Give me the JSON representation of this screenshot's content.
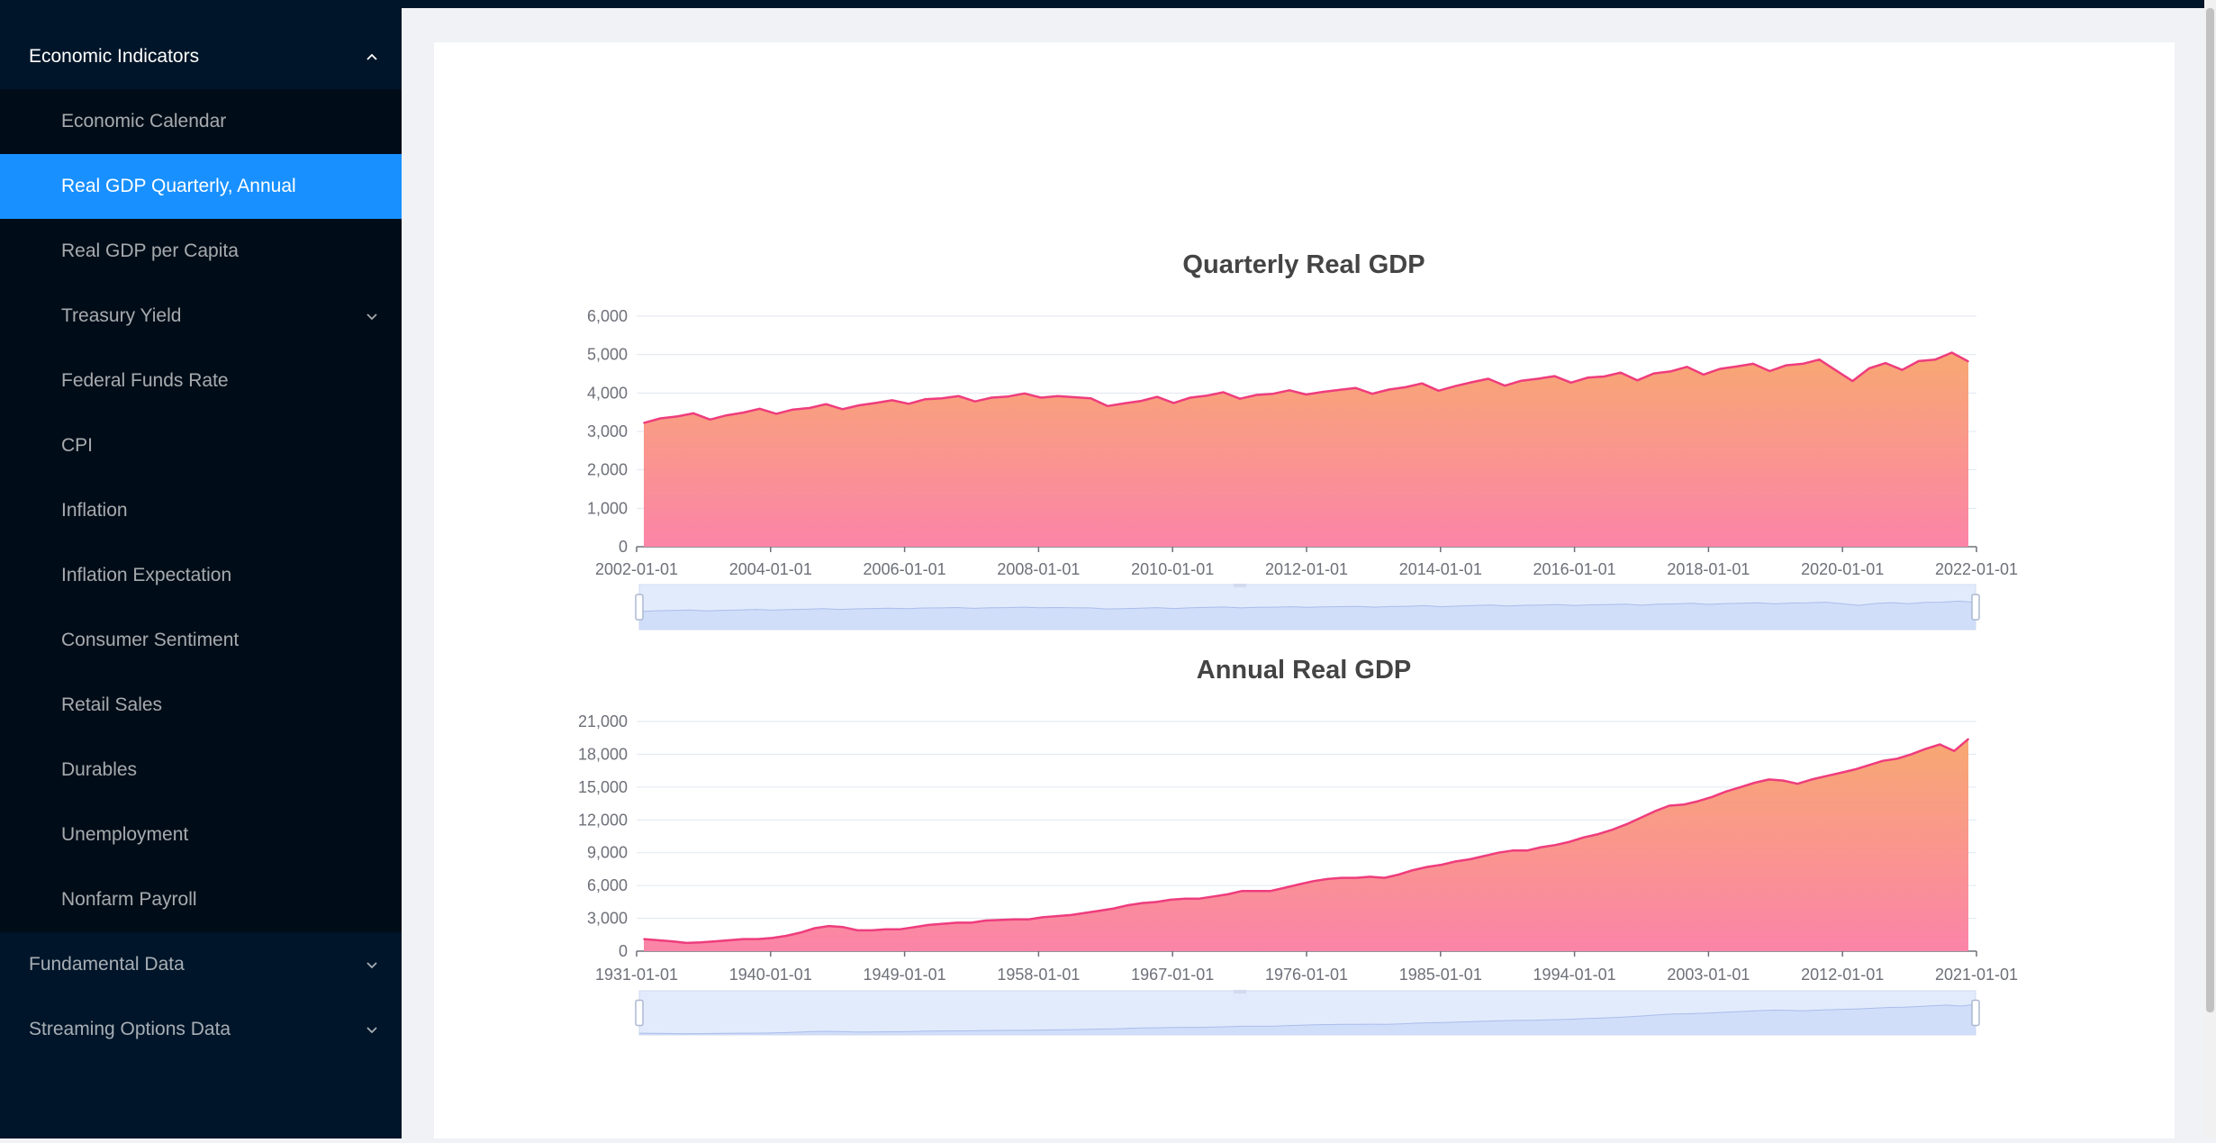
{
  "sidebar": {
    "groups": [
      {
        "label": "Economic Indicators",
        "open": true,
        "items": [
          {
            "label": "Economic Calendar"
          },
          {
            "label": "Real GDP Quarterly, Annual",
            "active": true
          },
          {
            "label": "Real GDP per Capita"
          },
          {
            "label": "Treasury Yield",
            "has_submenu": true
          },
          {
            "label": "Federal Funds Rate"
          },
          {
            "label": "CPI"
          },
          {
            "label": "Inflation"
          },
          {
            "label": "Inflation Expectation"
          },
          {
            "label": "Consumer Sentiment"
          },
          {
            "label": "Retail Sales"
          },
          {
            "label": "Durables"
          },
          {
            "label": "Unemployment"
          },
          {
            "label": "Nonfarm Payroll"
          }
        ]
      },
      {
        "label": "Fundamental Data",
        "open": false
      },
      {
        "label": "Streaming Options Data",
        "open": false
      }
    ]
  },
  "colors": {
    "sidebar_bg": "#001529",
    "submenu_bg": "#000c17",
    "active_item": "#1890ff",
    "area_top": "#f8a872",
    "area_bottom": "#fb84a8",
    "line": "#ee3d7d",
    "datazoom_fill": "#d6e2fb"
  },
  "chart_data": [
    {
      "type": "area",
      "title": "Quarterly Real GDP",
      "x_start": "2002-01-01",
      "x_step": "quarter",
      "x_ticks": [
        "2002-01-01",
        "2004-01-01",
        "2006-01-01",
        "2008-01-01",
        "2010-01-01",
        "2012-01-01",
        "2014-01-01",
        "2016-01-01",
        "2018-01-01",
        "2020-01-01",
        "2022-01-01"
      ],
      "y_ticks": [
        "0",
        "1,000",
        "2,000",
        "3,000",
        "4,000",
        "5,000",
        "6,000"
      ],
      "ylim": [
        0,
        6000
      ],
      "grid": true,
      "datazoom": true,
      "values": [
        3220,
        3340,
        3390,
        3470,
        3310,
        3420,
        3490,
        3590,
        3460,
        3570,
        3610,
        3710,
        3580,
        3680,
        3740,
        3810,
        3720,
        3840,
        3860,
        3920,
        3780,
        3880,
        3910,
        3990,
        3880,
        3920,
        3890,
        3860,
        3660,
        3730,
        3790,
        3900,
        3740,
        3880,
        3930,
        4020,
        3850,
        3950,
        3980,
        4070,
        3960,
        4030,
        4080,
        4130,
        3980,
        4090,
        4150,
        4250,
        4060,
        4180,
        4280,
        4370,
        4190,
        4320,
        4370,
        4440,
        4270,
        4400,
        4430,
        4530,
        4330,
        4510,
        4560,
        4680,
        4480,
        4630,
        4690,
        4760,
        4570,
        4720,
        4760,
        4870,
        4590,
        4310,
        4640,
        4780,
        4600,
        4830,
        4870,
        5050,
        4820
      ]
    },
    {
      "type": "area",
      "title": "Annual Real GDP",
      "x_start": "1931-01-01",
      "x_step": "year",
      "x_ticks": [
        "1931-01-01",
        "1940-01-01",
        "1949-01-01",
        "1958-01-01",
        "1967-01-01",
        "1976-01-01",
        "1985-01-01",
        "1994-01-01",
        "2003-01-01",
        "2012-01-01",
        "2021-01-01"
      ],
      "y_ticks": [
        "0",
        "3,000",
        "6,000",
        "9,000",
        "12,000",
        "15,000",
        "18,000",
        "21,000"
      ],
      "ylim": [
        0,
        21000
      ],
      "grid": true,
      "datazoom": true,
      "values": [
        1100,
        1000,
        900,
        750,
        800,
        900,
        1000,
        1100,
        1100,
        1200,
        1400,
        1700,
        2100,
        2300,
        2200,
        1900,
        1900,
        2000,
        2000,
        2200,
        2400,
        2500,
        2600,
        2600,
        2800,
        2850,
        2900,
        2900,
        3100,
        3200,
        3300,
        3500,
        3700,
        3900,
        4200,
        4400,
        4500,
        4700,
        4800,
        4800,
        5000,
        5200,
        5500,
        5500,
        5500,
        5800,
        6100,
        6400,
        6600,
        6700,
        6700,
        6800,
        6700,
        7000,
        7400,
        7700,
        7900,
        8200,
        8400,
        8700,
        9000,
        9200,
        9200,
        9500,
        9700,
        10000,
        10400,
        10700,
        11100,
        11600,
        12200,
        12800,
        13300,
        13400,
        13700,
        14100,
        14600,
        15000,
        15400,
        15700,
        15600,
        15300,
        15700,
        16000,
        16300,
        16600,
        17000,
        17400,
        17600,
        18000,
        18500,
        18900,
        18300,
        19400
      ]
    }
  ]
}
